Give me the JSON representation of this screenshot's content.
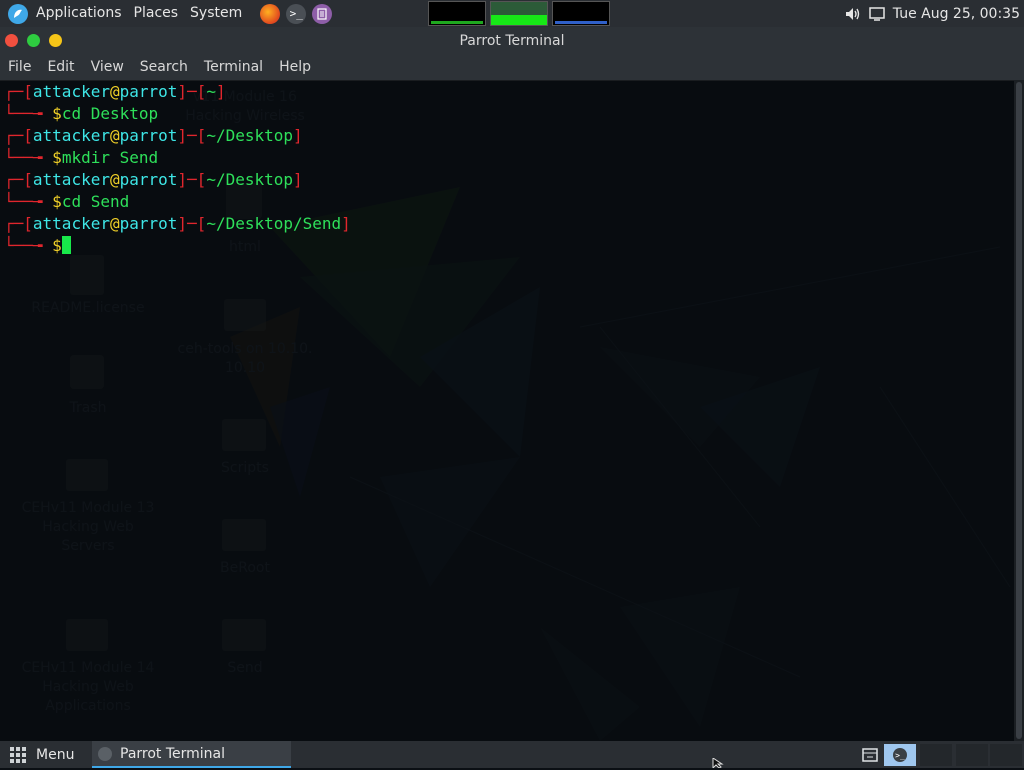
{
  "top_panel": {
    "menus": [
      "Applications",
      "Places",
      "System"
    ],
    "launchers": [
      "firefox-icon",
      "terminal-icon",
      "text-editor-icon"
    ],
    "clock": "Tue Aug 25, 00:35"
  },
  "window": {
    "title": "Parrot Terminal",
    "menu": [
      "File",
      "Edit",
      "View",
      "Search",
      "Terminal",
      "Help"
    ]
  },
  "terminal": {
    "user": "attacker",
    "host": "parrot",
    "at": "@",
    "prompt_symbol": "$",
    "entries": [
      {
        "dir": "~",
        "command": "cd Desktop"
      },
      {
        "dir": "~/Desktop",
        "command": "mkdir Send"
      },
      {
        "dir": "~/Desktop",
        "command": "cd Send"
      },
      {
        "dir": "~/Desktop/Send",
        "command": ""
      }
    ]
  },
  "bottom_panel": {
    "menu_label": "Menu",
    "task_label": "Parrot Terminal"
  },
  "colors": {
    "accent": "#3fa8e8",
    "prompt_red": "#e0262d",
    "prompt_green": "#2ee05a",
    "prompt_cyan": "#3ee6e6",
    "prompt_yellow": "#f0d028"
  }
}
